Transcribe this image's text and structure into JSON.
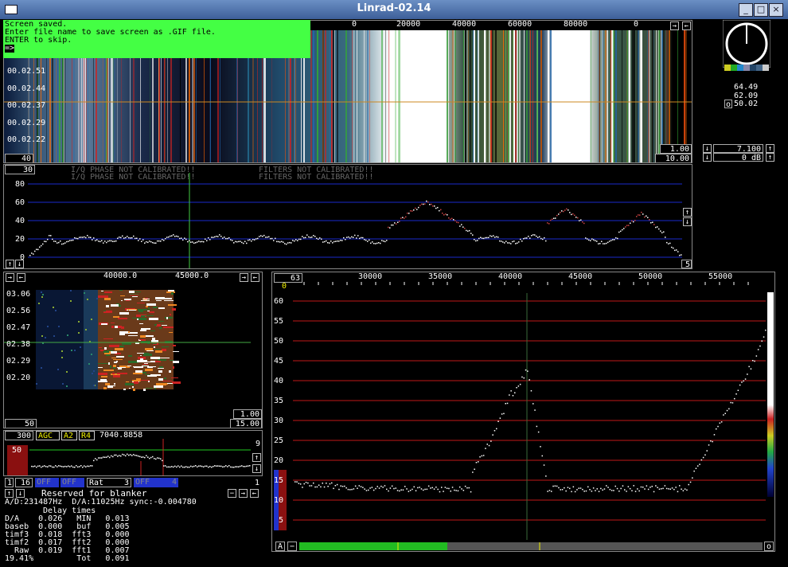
{
  "window": {
    "title": "Linrad-02.14",
    "buttons": [
      "_",
      "□",
      "×"
    ]
  },
  "status": {
    "lines": [
      "Screen saved.",
      "Enter file name to save screen as .GIF file.",
      "ENTER to skip.",
      "=>"
    ]
  },
  "main_waterfall": {
    "freq_labels": [
      "0",
      "20000",
      "40000",
      "60000",
      "80000",
      "0"
    ],
    "time_labels": [
      "00.02.51",
      "00.02.44",
      "00.02.37",
      "00.02.29",
      "00.02.22"
    ],
    "left_box": "40",
    "right_box_top": "1.00",
    "right_box_bottom": "10.00"
  },
  "s_meter": {
    "values": [
      "64.49",
      "62.09",
      "50.02"
    ],
    "o_label": "o"
  },
  "gain_controls": {
    "value1": "7.100",
    "value2": "0 dB"
  },
  "wide_spectrum": {
    "top_box": "30",
    "warnings": [
      "I/Q PHASE NOT CALIBRATED!!",
      "FILTERS NOT CALIBRATED!!"
    ],
    "y_labels": [
      "80",
      "60",
      "40",
      "20",
      "0"
    ],
    "right_box": "5"
  },
  "hires_waterfall": {
    "freq_labels": [
      "40000.0",
      "45000.0"
    ],
    "time_labels": [
      "03.06",
      "02.56",
      "02.47",
      "02.38",
      "02.29",
      "02.20"
    ],
    "left_box": "50",
    "right_box_top": "1.00",
    "right_box_bottom": "15.00"
  },
  "baseband": {
    "bw": "300",
    "agc": "AGC",
    "a2": "A2",
    "r4": "R4",
    "freq": "7040.8858",
    "left_value": "50",
    "scale_top": "9",
    "scale_bottom": "1"
  },
  "baseband_controls": {
    "num1": "1",
    "num2": "16",
    "off1": "OFF",
    "off2": "OFF",
    "rat": "Rat",
    "rat_val": "3",
    "off3": "OFF",
    "off3_val": "4"
  },
  "blanker": {
    "label": "Reserved for blanker"
  },
  "timing": {
    "ad_line": "A/D:231487Hz  D/A:11025Hz sync:-0.004780",
    "header": "Delay times",
    "rows": [
      "D/A    0.026   MIN   0.013",
      "baseb  0.000   buf   0.005",
      "timf3  0.018  fft3   0.000",
      "timf2  0.017  fft2   0.000",
      "  Raw  0.019  fft1   0.007",
      "19.41%         Tot   0.091"
    ]
  },
  "afc_spectrum": {
    "top_box": "63",
    "zero_label": "0",
    "freq_labels": [
      "30000",
      "35000",
      "40000",
      "45000",
      "50000",
      "55000"
    ],
    "y_labels": [
      "60",
      "55",
      "50",
      "45",
      "40",
      "35",
      "30",
      "25",
      "20",
      "15",
      "10",
      "5"
    ],
    "a_button": "A",
    "minus_button": "−",
    "o_button": "o"
  },
  "colors": {
    "grid_red": "#c01818",
    "grid_blue": "#1a2acc",
    "status_green": "#44ff44"
  }
}
